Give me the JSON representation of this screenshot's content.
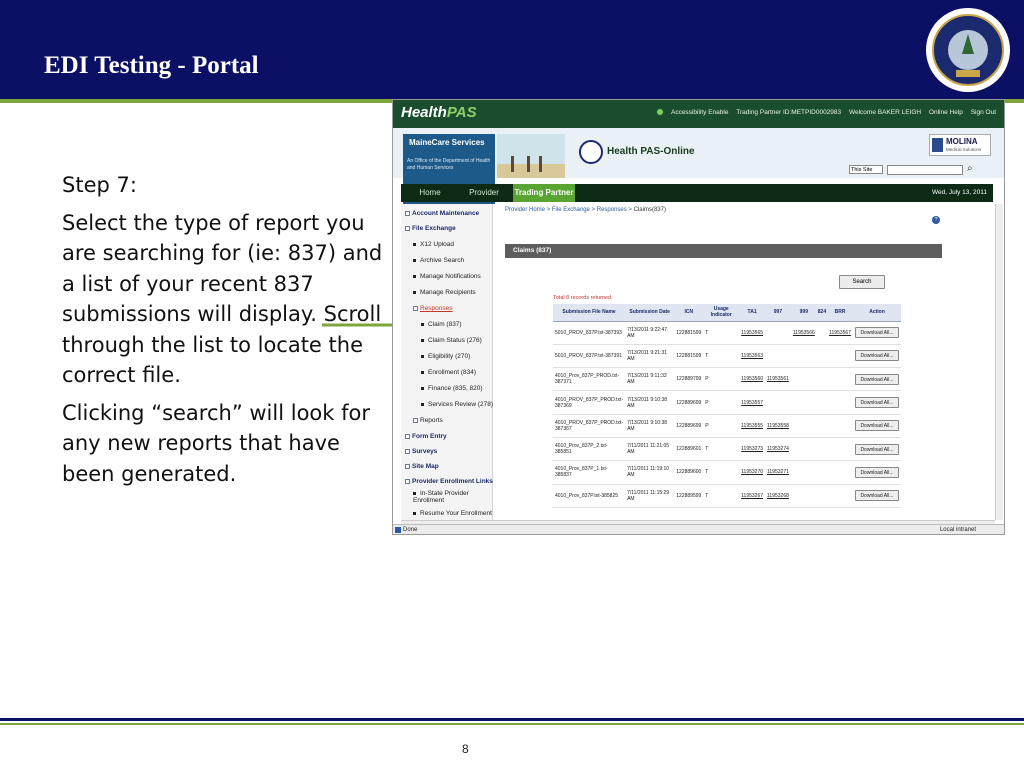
{
  "slide": {
    "title": "EDI Testing - Portal",
    "step": "Step 7:",
    "paragraph1": "Select the type of report you are searching for (ie: 837) and a list of your recent 837 submissions will display. Scroll through the list to locate the correct file.",
    "paragraph2": "Clicking “search” will look for any new reports that have been generated.",
    "page_number": "8"
  },
  "colors": {
    "header_navy": "#0c1064",
    "accent_green": "#7da53c",
    "portal_dark_green": "#1a4d2e",
    "tab_active_green": "#5aa433"
  },
  "portal": {
    "brand_health": "Health",
    "brand_pas": "PAS",
    "top_links": {
      "accessibility": "Accessibility Enable",
      "trading_partner": "Trading Partner ID:METPID0002983",
      "welcome": "Welcome BAKER LEIGH",
      "online_help": "Online Help",
      "sign_out": "Sign Out"
    },
    "banner": {
      "mainecare_title": "MaineCare Services",
      "mainecare_sub": "An Office of the Department of Health and Human Services",
      "health_pas_online": "Health PAS-Online",
      "molina": "MOLINA",
      "molina_sub": "Medical Solutions",
      "site_select": "This Site"
    },
    "nav": {
      "tabs": [
        "Home",
        "Provider",
        "Trading Partner"
      ],
      "active_tab": "Trading Partner",
      "date": "Wed, July 13, 2011"
    },
    "left_nav": {
      "account_maintenance": "Account Maintenance",
      "file_exchange": "File Exchange",
      "x12_upload": "X12 Upload",
      "archive_search": "Archive Search",
      "manage_notifications": "Manage Notifications",
      "manage_recipients": "Manage Recipients",
      "responses": "Responses",
      "claim_837": "Claim (837)",
      "claim_status": "Claim Status (276)",
      "eligibility": "Eligibility (270)",
      "enrollment": "Enrollment (834)",
      "finance": "Finance (835, 820)",
      "services_review": "Services Review (278)",
      "reports": "Reports",
      "form_entry": "Form Entry",
      "surveys": "Surveys",
      "site_map": "Site Map",
      "provider_enrollment": "Provider Enrollment Links",
      "in_state": "In-State Provider Enrollment",
      "resume": "Resume Your Enrollment"
    },
    "breadcrumb": {
      "provider_home": "Provider Home",
      "file_exchange": "File Exchange",
      "responses": "Responses",
      "current": "Claims(837)",
      "sep": " > "
    },
    "panel_title": "Claims (837)",
    "search_label": "Search",
    "records_text": "Total 8 records returned.",
    "table": {
      "headers": [
        "Submission File Name",
        "Submission Date",
        "ICN",
        "Usage Indicator",
        "TA1",
        "997",
        "999",
        "824",
        "BRR",
        "Action"
      ],
      "rows": [
        {
          "file": "5010_PROV_837P.txt-387393",
          "date": "7/13/2011 9:22:47 AM",
          "icn": "122881599",
          "usage": "T",
          "ta1": "11953565",
          "r997": "",
          "r999": "11953566",
          "r824": "",
          "brr": "11953567",
          "action": "Download All..."
        },
        {
          "file": "5010_PROV_837P.txt-387391",
          "date": "7/13/2011 9:21:31 AM",
          "icn": "122881599",
          "usage": "T",
          "ta1": "11953563",
          "r997": "",
          "r999": "",
          "r824": "",
          "brr": "",
          "action": "Download All..."
        },
        {
          "file": "4010_Prov_837P_PROD.txt-387371",
          "date": "7/13/2011 9:11:33 AM",
          "icn": "122889799",
          "usage": "P",
          "ta1": "11953560",
          "r997": "11953561",
          "r999": "",
          "r824": "",
          "brr": "",
          "action": "Download All..."
        },
        {
          "file": "4010_PROV_837P_PROD.txt-387369",
          "date": "7/13/2011 9:10:38 AM",
          "icn": "122889699",
          "usage": "P",
          "ta1": "11953557",
          "r997": "",
          "r999": "",
          "r824": "",
          "brr": "",
          "action": "Download All..."
        },
        {
          "file": "4010_PROV_837P_PROD.txt-387367",
          "date": "7/13/2011 9:10:38 AM",
          "icn": "122889699",
          "usage": "P",
          "ta1": "11953555",
          "r997": "11953558",
          "r999": "",
          "r824": "",
          "brr": "",
          "action": "Download All..."
        },
        {
          "file": "4010_Prov_837P_2.txt-385851",
          "date": "7/11/2011 11:21:05 AM",
          "icn": "122889601",
          "usage": "T",
          "ta1": "11953273",
          "r997": "11953274",
          "r999": "",
          "r824": "",
          "brr": "",
          "action": "Download All..."
        },
        {
          "file": "4010_Prov_837P_1.txt-385837",
          "date": "7/11/2011 11:19:10 AM",
          "icn": "122889600",
          "usage": "T",
          "ta1": "11953270",
          "r997": "11953271",
          "r999": "",
          "r824": "",
          "brr": "",
          "action": "Download All..."
        },
        {
          "file": "4010_Prov_837P.txt-385825",
          "date": "7/11/2011 11:15:29 AM",
          "icn": "122889599",
          "usage": "T",
          "ta1": "11953267",
          "r997": "11953268",
          "r999": "",
          "r824": "",
          "brr": "",
          "action": "Download All..."
        }
      ]
    },
    "status_bar": {
      "done": "Done",
      "zone": "Local intranet"
    }
  }
}
